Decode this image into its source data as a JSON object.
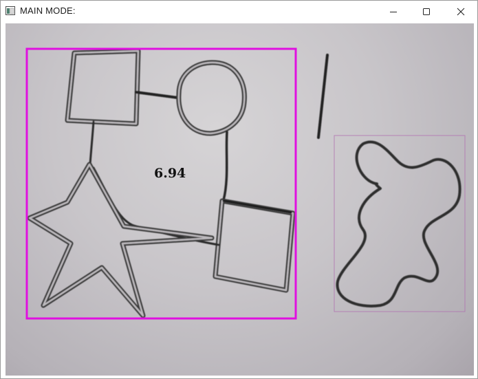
{
  "window": {
    "title": "MAIN MODE:",
    "controls": {
      "minimize": "minimize-icon",
      "maximize": "maximize-icon",
      "close": "close-icon"
    }
  },
  "canvas": {
    "measurement_label": "6.94",
    "colors": {
      "bounding_box": "#e010e0",
      "secondary_box": "#b070b0",
      "sketch_stroke": "#2a2a2a",
      "paper": "#c8c5c9"
    }
  }
}
